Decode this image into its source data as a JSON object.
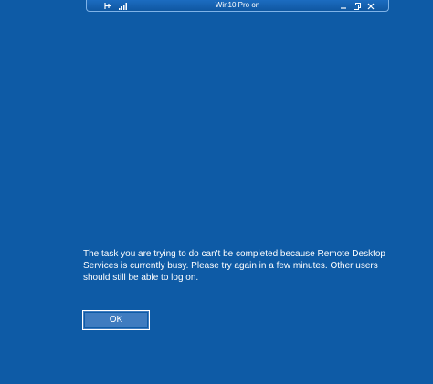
{
  "connection_bar": {
    "title": "Win10 Pro on",
    "icons": [
      "pin-icon",
      "signal-strength-icon",
      "minimize-icon",
      "restore-icon",
      "close-icon"
    ]
  },
  "dialog": {
    "message": "The task you are trying to do can't be completed because Remote Desktop Services is currently busy. Please try again in a few minutes. Other users should still be able to log on.",
    "ok_label": "OK"
  },
  "colors": {
    "background": "#0e5ba6",
    "button": "#3f7cc0",
    "text": "#ffffff"
  }
}
